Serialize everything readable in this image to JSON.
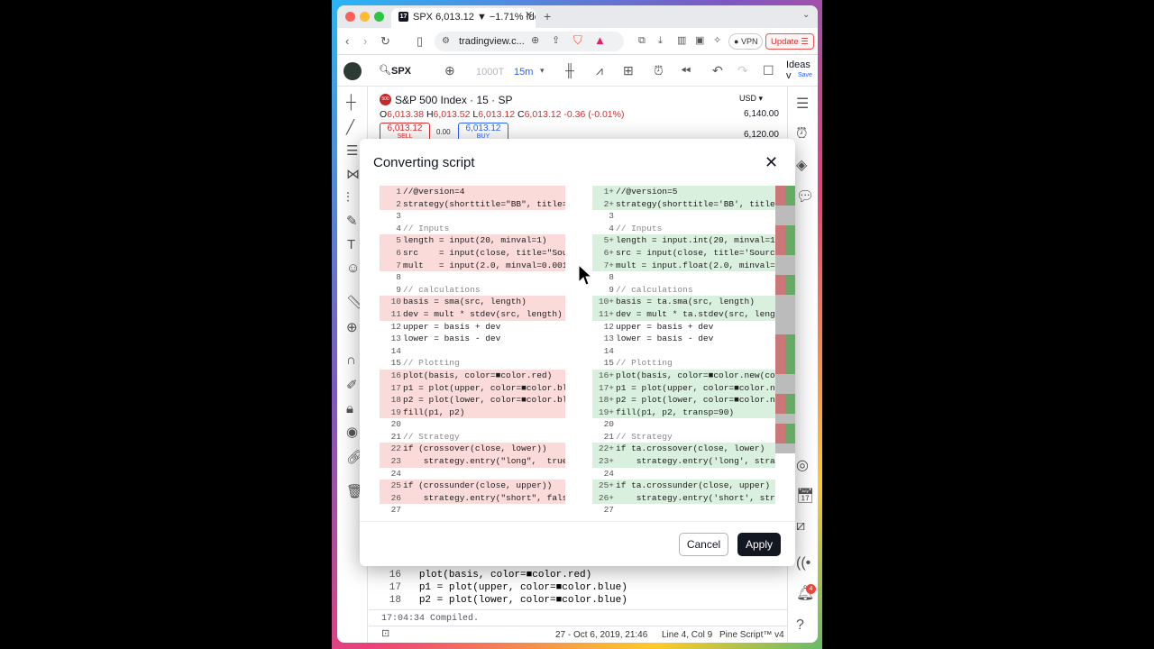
{
  "browser": {
    "tab_title": "SPX 6,013.12 ▼ −1.71% Ideas",
    "url": "tradingview.c...",
    "vpn_label": "VPN",
    "update_label": "Update"
  },
  "toolbar": {
    "symbol": "SPX",
    "interval_muted": "1000T",
    "interval": "15m",
    "ideas_label": "Ideas v",
    "save_label": "Save"
  },
  "chart": {
    "title": "S&P 500 Index · 15 · SP",
    "ohlc": {
      "o": "6,013.38",
      "h": "6,013.52",
      "l": "6,013.12",
      "c": "6,013.12",
      "change": "-0.36 (-0.01%)"
    },
    "sell_price": "6,013.12",
    "sell_label": "SELL",
    "spread": "0.00",
    "buy_price": "6,013.12",
    "buy_label": "BUY",
    "currency": "USD",
    "prices": [
      "6,140.00",
      "6,120.00"
    ]
  },
  "dialog": {
    "title": "Converting script",
    "cancel_label": "Cancel",
    "apply_label": "Apply"
  },
  "diff": {
    "left": [
      {
        "n": "1",
        "t": "//@version=4",
        "k": "rem"
      },
      {
        "n": "2",
        "t": "strategy(shorttitle=\"BB\", title=\"",
        "k": "rem"
      },
      {
        "n": "3",
        "t": "",
        "k": ""
      },
      {
        "n": "4",
        "t": "// Inputs",
        "k": "cm"
      },
      {
        "n": "5",
        "t": "length = input(20, minval=1)",
        "k": "rem"
      },
      {
        "n": "6",
        "t": "src    = input(close, title=\"Source",
        "k": "rem"
      },
      {
        "n": "7",
        "t": "mult   = input(2.0, minval=0.001,",
        "k": "rem"
      },
      {
        "n": "8",
        "t": "",
        "k": ""
      },
      {
        "n": "9",
        "t": "// calculations",
        "k": "cm"
      },
      {
        "n": "10",
        "t": "basis = sma(src, length)",
        "k": "rem"
      },
      {
        "n": "11",
        "t": "dev = mult * stdev(src, length)",
        "k": "rem"
      },
      {
        "n": "12",
        "t": "upper = basis + dev",
        "k": ""
      },
      {
        "n": "13",
        "t": "lower = basis - dev",
        "k": ""
      },
      {
        "n": "14",
        "t": "",
        "k": ""
      },
      {
        "n": "15",
        "t": "// Plotting",
        "k": "cm"
      },
      {
        "n": "16",
        "t": "plot(basis, color=■color.red)",
        "k": "rem"
      },
      {
        "n": "17",
        "t": "p1 = plot(upper, color=■color.blu",
        "k": "rem"
      },
      {
        "n": "18",
        "t": "p2 = plot(lower, color=■color.blu",
        "k": "rem"
      },
      {
        "n": "19",
        "t": "fill(p1, p2)",
        "k": "rem"
      },
      {
        "n": "20",
        "t": "",
        "k": ""
      },
      {
        "n": "21",
        "t": "// Strategy",
        "k": "cm"
      },
      {
        "n": "22",
        "t": "if (crossover(close, lower))",
        "k": "rem"
      },
      {
        "n": "23",
        "t": "    strategy.entry(\"long\",  true)",
        "k": "rem"
      },
      {
        "n": "24",
        "t": "",
        "k": ""
      },
      {
        "n": "25",
        "t": "if (crossunder(close, upper))",
        "k": "rem"
      },
      {
        "n": "26",
        "t": "    strategy.entry(\"short\", false",
        "k": "rem"
      },
      {
        "n": "27",
        "t": "",
        "k": ""
      }
    ],
    "right": [
      {
        "n": "1+",
        "t": "//@version=5",
        "k": "add"
      },
      {
        "n": "2+",
        "t": "strategy(shorttitle='BB', title='B",
        "k": "add"
      },
      {
        "n": "3",
        "t": "",
        "k": ""
      },
      {
        "n": "4",
        "t": "// Inputs",
        "k": "cm"
      },
      {
        "n": "5+",
        "t": "length = input.int(20, minval=1)",
        "k": "add"
      },
      {
        "n": "6+",
        "t": "src = input(close, title='Source'",
        "k": "add"
      },
      {
        "n": "7+",
        "t": "mult = input.float(2.0, minval=0.0",
        "k": "add"
      },
      {
        "n": "8",
        "t": "",
        "k": ""
      },
      {
        "n": "9",
        "t": "// calculations",
        "k": "cm"
      },
      {
        "n": "10+",
        "t": "basis = ta.sma(src, length)",
        "k": "add"
      },
      {
        "n": "11+",
        "t": "dev = mult * ta.stdev(src, length)",
        "k": "add"
      },
      {
        "n": "12",
        "t": "upper = basis + dev",
        "k": ""
      },
      {
        "n": "13",
        "t": "lower = basis - dev",
        "k": ""
      },
      {
        "n": "14",
        "t": "",
        "k": ""
      },
      {
        "n": "15",
        "t": "// Plotting",
        "k": "cm"
      },
      {
        "n": "16+",
        "t": "plot(basis, color=■color.new(col",
        "k": "add"
      },
      {
        "n": "17+",
        "t": "p1 = plot(upper, color=■color.new",
        "k": "add"
      },
      {
        "n": "18+",
        "t": "p2 = plot(lower, color=■color.new",
        "k": "add"
      },
      {
        "n": "19+",
        "t": "fill(p1, p2, transp=90)",
        "k": "add"
      },
      {
        "n": "20",
        "t": "",
        "k": ""
      },
      {
        "n": "21",
        "t": "// Strategy",
        "k": "cm"
      },
      {
        "n": "22+",
        "t": "if ta.crossover(close, lower)",
        "k": "add"
      },
      {
        "n": "23+",
        "t": "    strategy.entry('long', strateg",
        "k": "add"
      },
      {
        "n": "24",
        "t": "",
        "k": ""
      },
      {
        "n": "25+",
        "t": "if ta.crossunder(close, upper)",
        "k": "add"
      },
      {
        "n": "26+",
        "t": "    strategy.entry('short', strate",
        "k": "add"
      },
      {
        "n": "27",
        "t": "",
        "k": ""
      }
    ]
  },
  "editor": {
    "lines": [
      {
        "n": "16",
        "t": "plot(basis, color=■color.red)"
      },
      {
        "n": "17",
        "t": "p1 = plot(upper, color=■color.blue)"
      },
      {
        "n": "18",
        "t": "p2 = plot(lower, color=■color.blue)"
      }
    ],
    "console_line": "17:04:34  Compiled."
  },
  "statusbar": {
    "date": "27 - Oct 6, 2019, 21:46",
    "position": "Line 4, Col 9",
    "version": "Pine Script™ v4"
  },
  "notifications_count": "4",
  "colors": {
    "removed": "#fbdada",
    "added": "#d8f0dd",
    "accent": "#2962ff",
    "sell": "#d32f2f"
  }
}
